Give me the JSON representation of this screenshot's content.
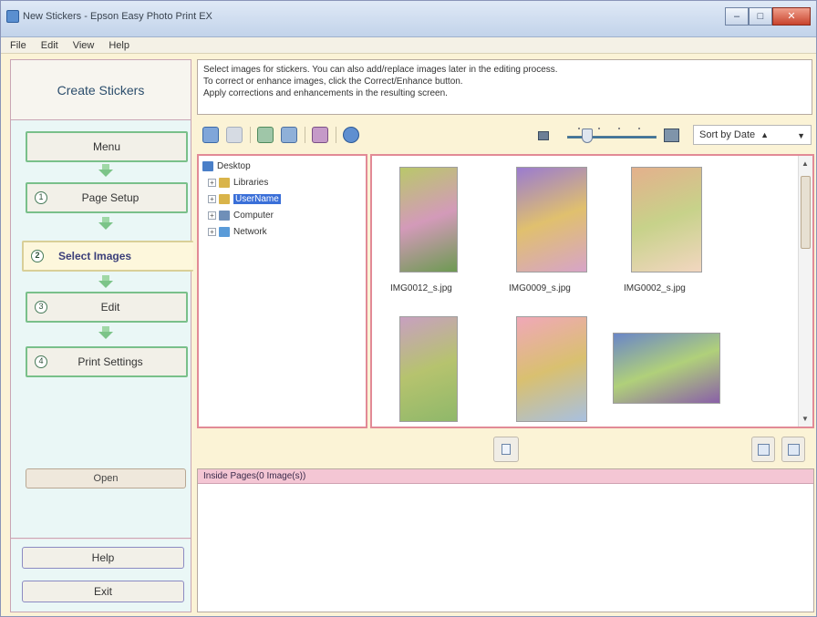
{
  "window": {
    "title": "New Stickers - Epson Easy Photo Print EX",
    "controls": {
      "minimize": "–",
      "maximize": "□",
      "close": "✕"
    }
  },
  "menu": [
    "File",
    "Edit",
    "View",
    "Help"
  ],
  "sidebar": {
    "title": "Create Stickers",
    "steps": [
      {
        "label": "Menu",
        "number": ""
      },
      {
        "label": "Page Setup",
        "number": "1"
      },
      {
        "label": "Select Images",
        "number": "2"
      },
      {
        "label": "Edit",
        "number": "3"
      },
      {
        "label": "Print Settings",
        "number": "4"
      }
    ],
    "open_button": "Open",
    "help_button": "Help",
    "exit_button": "Exit"
  },
  "instructions": {
    "line1": "Select images for stickers. You can also add/replace images later in the editing process.",
    "line2": "To correct or enhance images, click the Correct/Enhance button.",
    "line3": "Apply corrections and enhancements in the resulting screen."
  },
  "toolbar": {
    "sort_label": "Sort by Date",
    "sort_arrow": "▲",
    "dropdown_caret": "▼"
  },
  "tree": {
    "items": [
      {
        "label": "Desktop",
        "selected": false,
        "icon": "desktop-icon",
        "color": "#4a7fc8"
      },
      {
        "label": "Libraries",
        "selected": false,
        "icon": "libraries-icon",
        "color": "#d9b44a"
      },
      {
        "label": "UserName",
        "selected": true,
        "icon": "user-folder-icon",
        "color": "#d9b44a"
      },
      {
        "label": "Computer",
        "selected": false,
        "icon": "computer-icon",
        "color": "#6f8fb8"
      },
      {
        "label": "Network",
        "selected": false,
        "icon": "network-icon",
        "color": "#5a9bd8"
      }
    ]
  },
  "thumbnails": [
    {
      "file": "IMG0012_s.jpg",
      "colors": [
        "#b9c86a",
        "#d39ab9",
        "#6d9a52"
      ]
    },
    {
      "file": "IMG0009_s.jpg",
      "colors": [
        "#9a7bd0",
        "#e0c06e",
        "#d7a4c8"
      ]
    },
    {
      "file": "IMG0002_s.jpg",
      "colors": [
        "#e4b08c",
        "#c7d28a",
        "#f2d6c0"
      ]
    },
    {
      "file": "",
      "colors": [
        "#c8a0c0",
        "#b6c36e",
        "#8fb86a"
      ]
    },
    {
      "file": "",
      "colors": [
        "#f0a8b8",
        "#d9c070",
        "#a8c0e0"
      ]
    },
    {
      "file": "",
      "colors": [
        "#6a86c8",
        "#b0d07a",
        "#8a60a8"
      ]
    }
  ],
  "pages_panel": {
    "header": "Inside Pages(0 Image(s))"
  },
  "colors": {
    "accent_pink_border": "#e28a96",
    "step_border_green": "#79c08a",
    "sidebar_bg": "#eaf7f6",
    "pages_header_bg": "#f4c6d4"
  }
}
